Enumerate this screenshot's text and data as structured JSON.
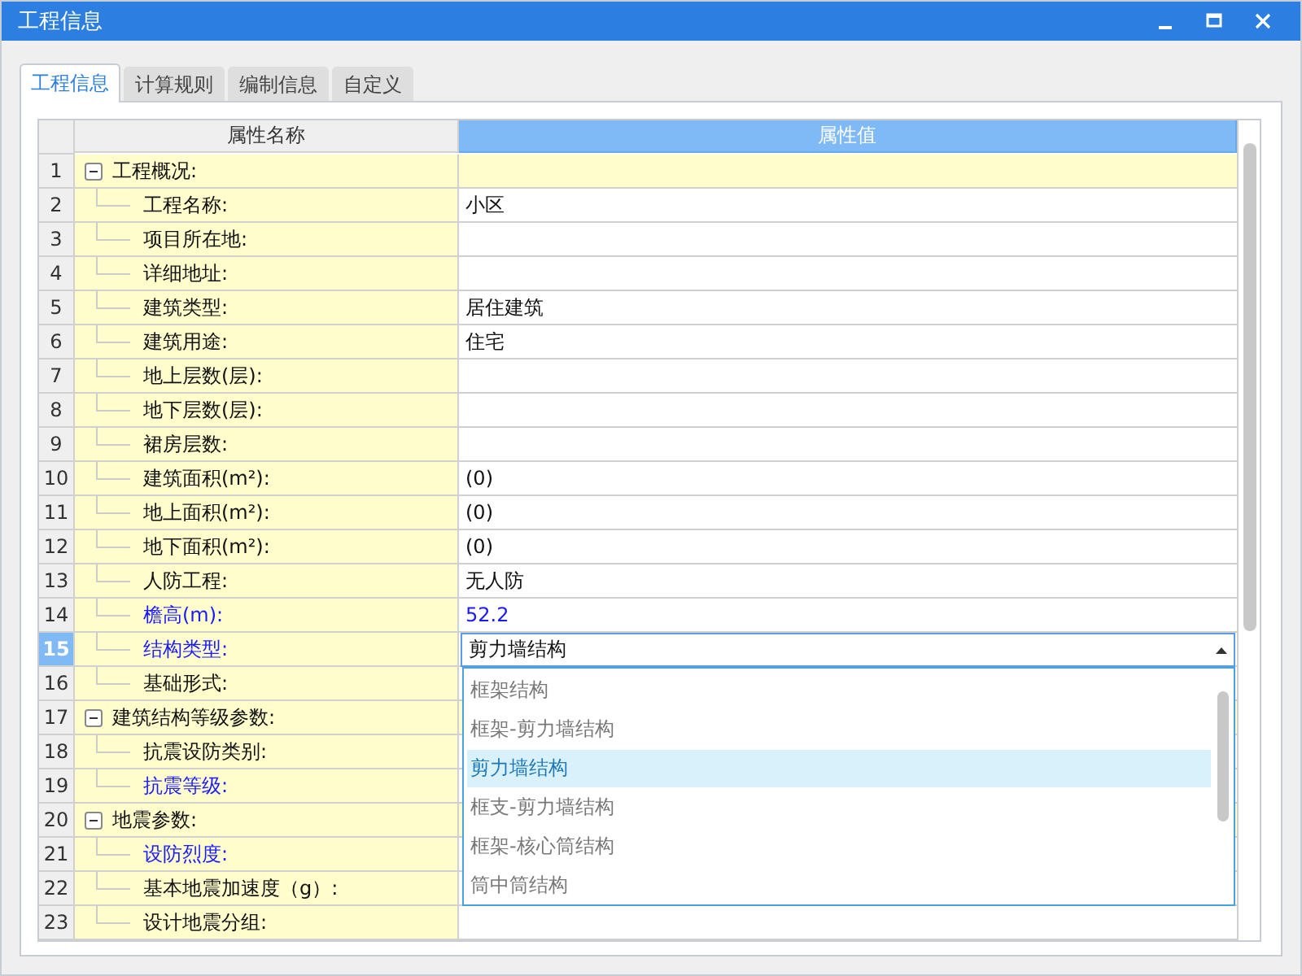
{
  "window": {
    "title": "工程信息"
  },
  "tabs": [
    {
      "label": "工程信息",
      "selected": true
    },
    {
      "label": "计算规则",
      "selected": false
    },
    {
      "label": "编制信息",
      "selected": false
    },
    {
      "label": "自定义",
      "selected": false
    }
  ],
  "table": {
    "columns": [
      "属性名称",
      "属性值"
    ],
    "rows": [
      {
        "number": "1",
        "kind": "group",
        "name": "工程概况:",
        "value": "",
        "highlighted": false,
        "selected": false
      },
      {
        "number": "2",
        "kind": "item",
        "name": "工程名称:",
        "value": "小区",
        "highlighted": false,
        "selected": false
      },
      {
        "number": "3",
        "kind": "item",
        "name": "项目所在地:",
        "value": "",
        "highlighted": false,
        "selected": false
      },
      {
        "number": "4",
        "kind": "item",
        "name": "详细地址:",
        "value": "",
        "highlighted": false,
        "selected": false
      },
      {
        "number": "5",
        "kind": "item",
        "name": "建筑类型:",
        "value": "居住建筑",
        "highlighted": false,
        "selected": false
      },
      {
        "number": "6",
        "kind": "item",
        "name": "建筑用途:",
        "value": "住宅",
        "highlighted": false,
        "selected": false
      },
      {
        "number": "7",
        "kind": "item",
        "name": "地上层数(层):",
        "value": "",
        "highlighted": false,
        "selected": false
      },
      {
        "number": "8",
        "kind": "item",
        "name": "地下层数(层):",
        "value": "",
        "highlighted": false,
        "selected": false
      },
      {
        "number": "9",
        "kind": "item",
        "name": "裙房层数:",
        "value": "",
        "highlighted": false,
        "selected": false
      },
      {
        "number": "10",
        "kind": "item",
        "name": "建筑面积(m²):",
        "value": "(0)",
        "highlighted": false,
        "selected": false
      },
      {
        "number": "11",
        "kind": "item",
        "name": "地上面积(m²):",
        "value": "(0)",
        "highlighted": false,
        "selected": false
      },
      {
        "number": "12",
        "kind": "item",
        "name": "地下面积(m²):",
        "value": "(0)",
        "highlighted": false,
        "selected": false
      },
      {
        "number": "13",
        "kind": "item",
        "name": "人防工程:",
        "value": "无人防",
        "highlighted": false,
        "selected": false
      },
      {
        "number": "14",
        "kind": "item",
        "name": "檐高(m):",
        "value": "52.2",
        "highlighted": true,
        "selected": false
      },
      {
        "number": "15",
        "kind": "item",
        "name": "结构类型:",
        "value": "剪力墙结构",
        "highlighted": true,
        "selected": true
      },
      {
        "number": "16",
        "kind": "item",
        "name": "基础形式:",
        "value": "",
        "highlighted": false,
        "selected": false
      },
      {
        "number": "17",
        "kind": "group",
        "name": "建筑结构等级参数:",
        "value": "",
        "highlighted": false,
        "selected": false
      },
      {
        "number": "18",
        "kind": "item",
        "name": "抗震设防类别:",
        "value": "",
        "highlighted": false,
        "selected": false
      },
      {
        "number": "19",
        "kind": "item",
        "name": "抗震等级:",
        "value": "",
        "highlighted": true,
        "selected": false
      },
      {
        "number": "20",
        "kind": "group",
        "name": "地震参数:",
        "value": "",
        "highlighted": false,
        "selected": false
      },
      {
        "number": "21",
        "kind": "item",
        "name": "设防烈度:",
        "value": "",
        "highlighted": true,
        "selected": false
      },
      {
        "number": "22",
        "kind": "item",
        "name": "基本地震加速度（g）:",
        "value": "",
        "highlighted": false,
        "selected": false
      },
      {
        "number": "23",
        "kind": "item",
        "name": "设计地震分组:",
        "value": "",
        "highlighted": false,
        "selected": false
      }
    ]
  },
  "dropdown": {
    "options": [
      {
        "label": "框架结构",
        "selected": false
      },
      {
        "label": "框架-剪力墙结构",
        "selected": false
      },
      {
        "label": "剪力墙结构",
        "selected": true
      },
      {
        "label": "框支-剪力墙结构",
        "selected": false
      },
      {
        "label": "框架-核心筒结构",
        "selected": false
      },
      {
        "label": "筒中筒结构",
        "selected": false
      }
    ]
  }
}
